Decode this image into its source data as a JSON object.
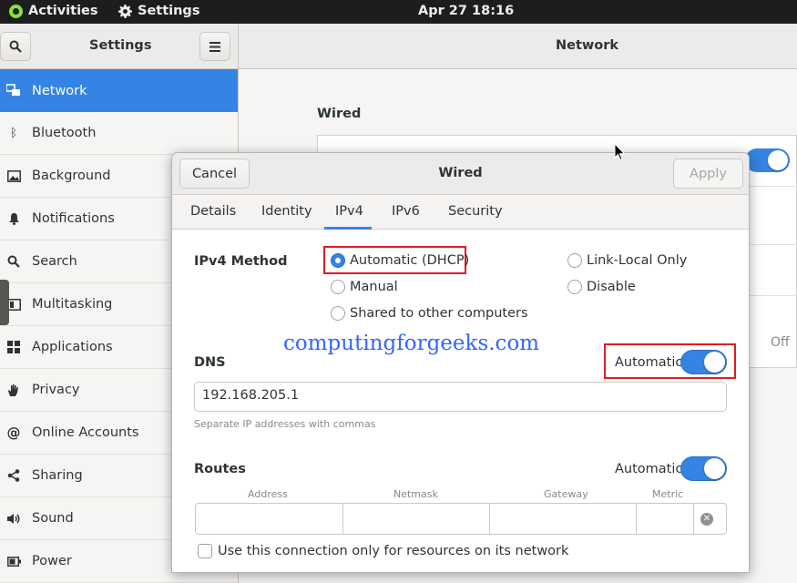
{
  "topbar": {
    "activities": "Activities",
    "app": "Settings",
    "clock": "Apr 27  18:16"
  },
  "sidebar": {
    "title": "Settings",
    "items": [
      {
        "label": "Network",
        "icon": "network-icon"
      },
      {
        "label": "Bluetooth",
        "icon": "bluetooth-icon"
      },
      {
        "label": "Background",
        "icon": "background-icon"
      },
      {
        "label": "Notifications",
        "icon": "bell-icon"
      },
      {
        "label": "Search",
        "icon": "search-icon"
      },
      {
        "label": "Multitasking",
        "icon": "multitasking-icon"
      },
      {
        "label": "Applications",
        "icon": "applications-icon"
      },
      {
        "label": "Privacy",
        "icon": "hand-icon"
      },
      {
        "label": "Online Accounts",
        "icon": "at-icon"
      },
      {
        "label": "Sharing",
        "icon": "share-icon"
      },
      {
        "label": "Sound",
        "icon": "speaker-icon"
      },
      {
        "label": "Power",
        "icon": "power-icon"
      }
    ]
  },
  "main": {
    "title": "Network",
    "wired_label": "Wired",
    "off_label": "Off"
  },
  "dialog": {
    "title": "Wired",
    "cancel": "Cancel",
    "apply": "Apply",
    "tabs": [
      "Details",
      "Identity",
      "IPv4",
      "IPv6",
      "Security"
    ],
    "active_tab": "IPv4",
    "ipv4_method_label": "IPv4 Method",
    "methods": {
      "automatic": "Automatic (DHCP)",
      "manual": "Manual",
      "shared": "Shared to other computers",
      "link_local": "Link-Local Only",
      "disable": "Disable"
    },
    "selected_method": "Automatic (DHCP)",
    "watermark": "computingforgeeks.com",
    "dns_label": "DNS",
    "dns_automatic_label": "Automatic",
    "dns_automatic": true,
    "dns_value": "192.168.205.1",
    "dns_hint": "Separate IP addresses with commas",
    "routes_label": "Routes",
    "routes_automatic_label": "Automatic",
    "routes_automatic": true,
    "route_columns": [
      "Address",
      "Netmask",
      "Gateway",
      "Metric"
    ],
    "only_local_label": "Use this connection only for resources on its network"
  },
  "colors": {
    "accent": "#3584e4",
    "highlight_box": "#e01b24",
    "watermark": "#3465ff"
  }
}
